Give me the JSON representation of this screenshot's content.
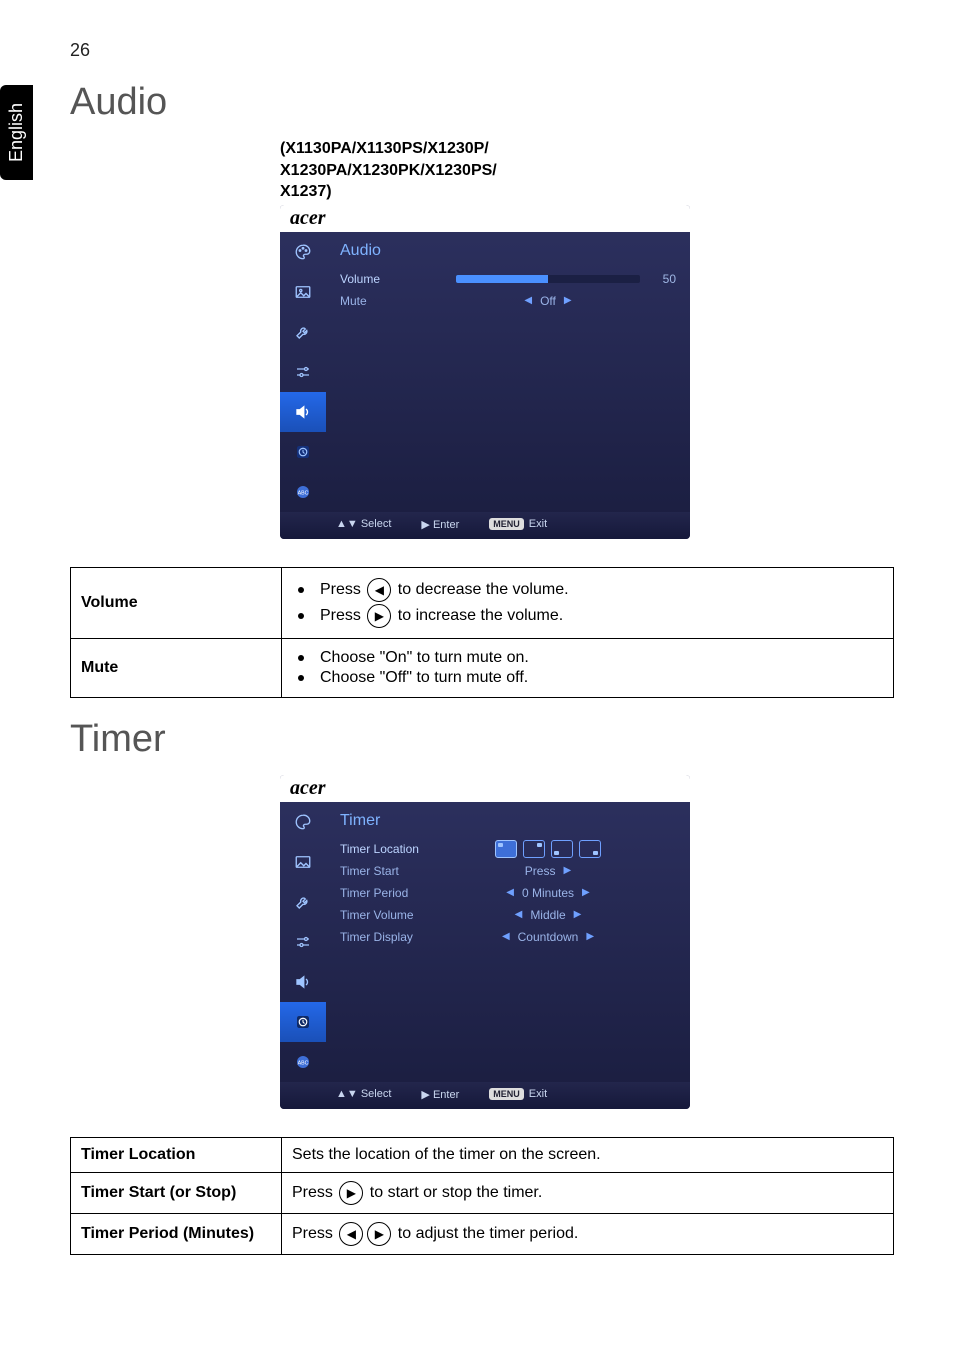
{
  "page_number": "26",
  "language_tab": "English",
  "sections": {
    "audio_title": "Audio",
    "timer_title": "Timer"
  },
  "models_note": {
    "line1": "(X1130PA/X1130PS/X1230P/",
    "line2": "X1230PA/X1230PK/X1230PS/",
    "line3": "X1237)"
  },
  "osd": {
    "brand": "acer",
    "footer": {
      "select": "Select",
      "enter": "Enter",
      "menu_pill": "MENU",
      "exit": "Exit"
    }
  },
  "audio_osd": {
    "title": "Audio",
    "rows": {
      "volume": {
        "label": "Volume",
        "value": "50",
        "fill_pct": 50
      },
      "mute": {
        "label": "Mute",
        "value": "Off"
      }
    }
  },
  "timer_osd": {
    "title": "Timer",
    "rows": {
      "location": {
        "label": "Timer Location"
      },
      "start": {
        "label": "Timer Start",
        "value": "Press"
      },
      "period": {
        "label": "Timer Period",
        "value": "0  Minutes"
      },
      "volume": {
        "label": "Timer Volume",
        "value": "Middle"
      },
      "display": {
        "label": "Timer Display",
        "value": "Countdown"
      }
    }
  },
  "audio_table": {
    "volume": {
      "label": "Volume",
      "dec": "Press ",
      "dec2": " to decrease the volume.",
      "inc": "Press ",
      "inc2": " to increase the volume."
    },
    "mute": {
      "label": "Mute",
      "on": "Choose \"On\" to turn mute on.",
      "off": "Choose \"Off\" to turn mute off."
    }
  },
  "timer_table": {
    "location": {
      "label": "Timer Location",
      "desc": "Sets the location of the timer on the screen."
    },
    "start": {
      "label": "Timer Start (or Stop)",
      "desc1": "Press ",
      "desc2": " to start or stop the timer."
    },
    "period": {
      "label": "Timer Period (Minutes)",
      "desc1": "Press ",
      "desc2": " to adjust the timer period."
    }
  }
}
